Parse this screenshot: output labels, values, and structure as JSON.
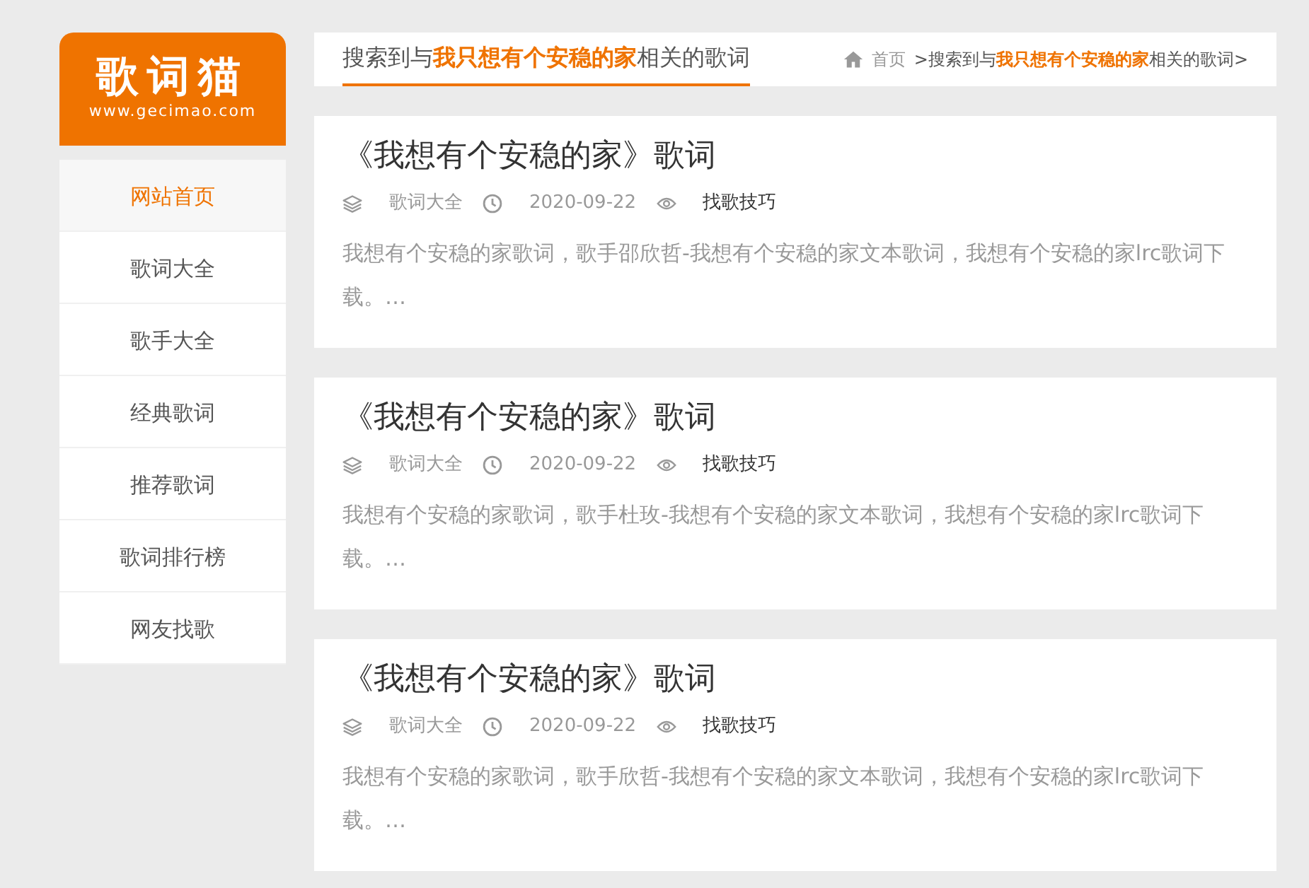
{
  "logo": {
    "title": "歌词猫",
    "url": "www.gecimao.com"
  },
  "nav": [
    {
      "label": "网站首页",
      "selected": true
    },
    {
      "label": "歌词大全",
      "selected": false
    },
    {
      "label": "歌手大全",
      "selected": false
    },
    {
      "label": "经典歌词",
      "selected": false
    },
    {
      "label": "推荐歌词",
      "selected": false
    },
    {
      "label": "歌词排行榜",
      "selected": false
    },
    {
      "label": "网友找歌",
      "selected": false
    }
  ],
  "header": {
    "title": "搜索到与**我只想有个安稳的家**相关的歌词",
    "breadcrumb_home": "首页",
    "breadcrumb_current": ">搜索到与**我只想有个安稳的家**相关的歌词>"
  },
  "articles": [
    {
      "title": "《我想有个安稳的家》歌词",
      "category": "歌词大全",
      "date": "2020-09-22",
      "tag": "找歌技巧",
      "summary": "我想有个安稳的家歌词，歌手邵欣哲-我想有个安稳的家文本歌词，我想有个安稳的家lrc歌词下载。",
      "more": "…"
    },
    {
      "title": "《我想有个安稳的家》歌词",
      "category": "歌词大全",
      "date": "2020-09-22",
      "tag": "找歌技巧",
      "summary": "我想有个安稳的家歌词，歌手杜玫-我想有个安稳的家文本歌词，我想有个安稳的家lrc歌词下载。",
      "more": "…"
    },
    {
      "title": "《我想有个安稳的家》歌词",
      "category": "歌词大全",
      "date": "2020-09-22",
      "tag": "找歌技巧",
      "summary": "我想有个安稳的家歌词，歌手欣哲-我想有个安稳的家文本歌词，我想有个安稳的家lrc歌词下载。",
      "more": "…"
    }
  ]
}
